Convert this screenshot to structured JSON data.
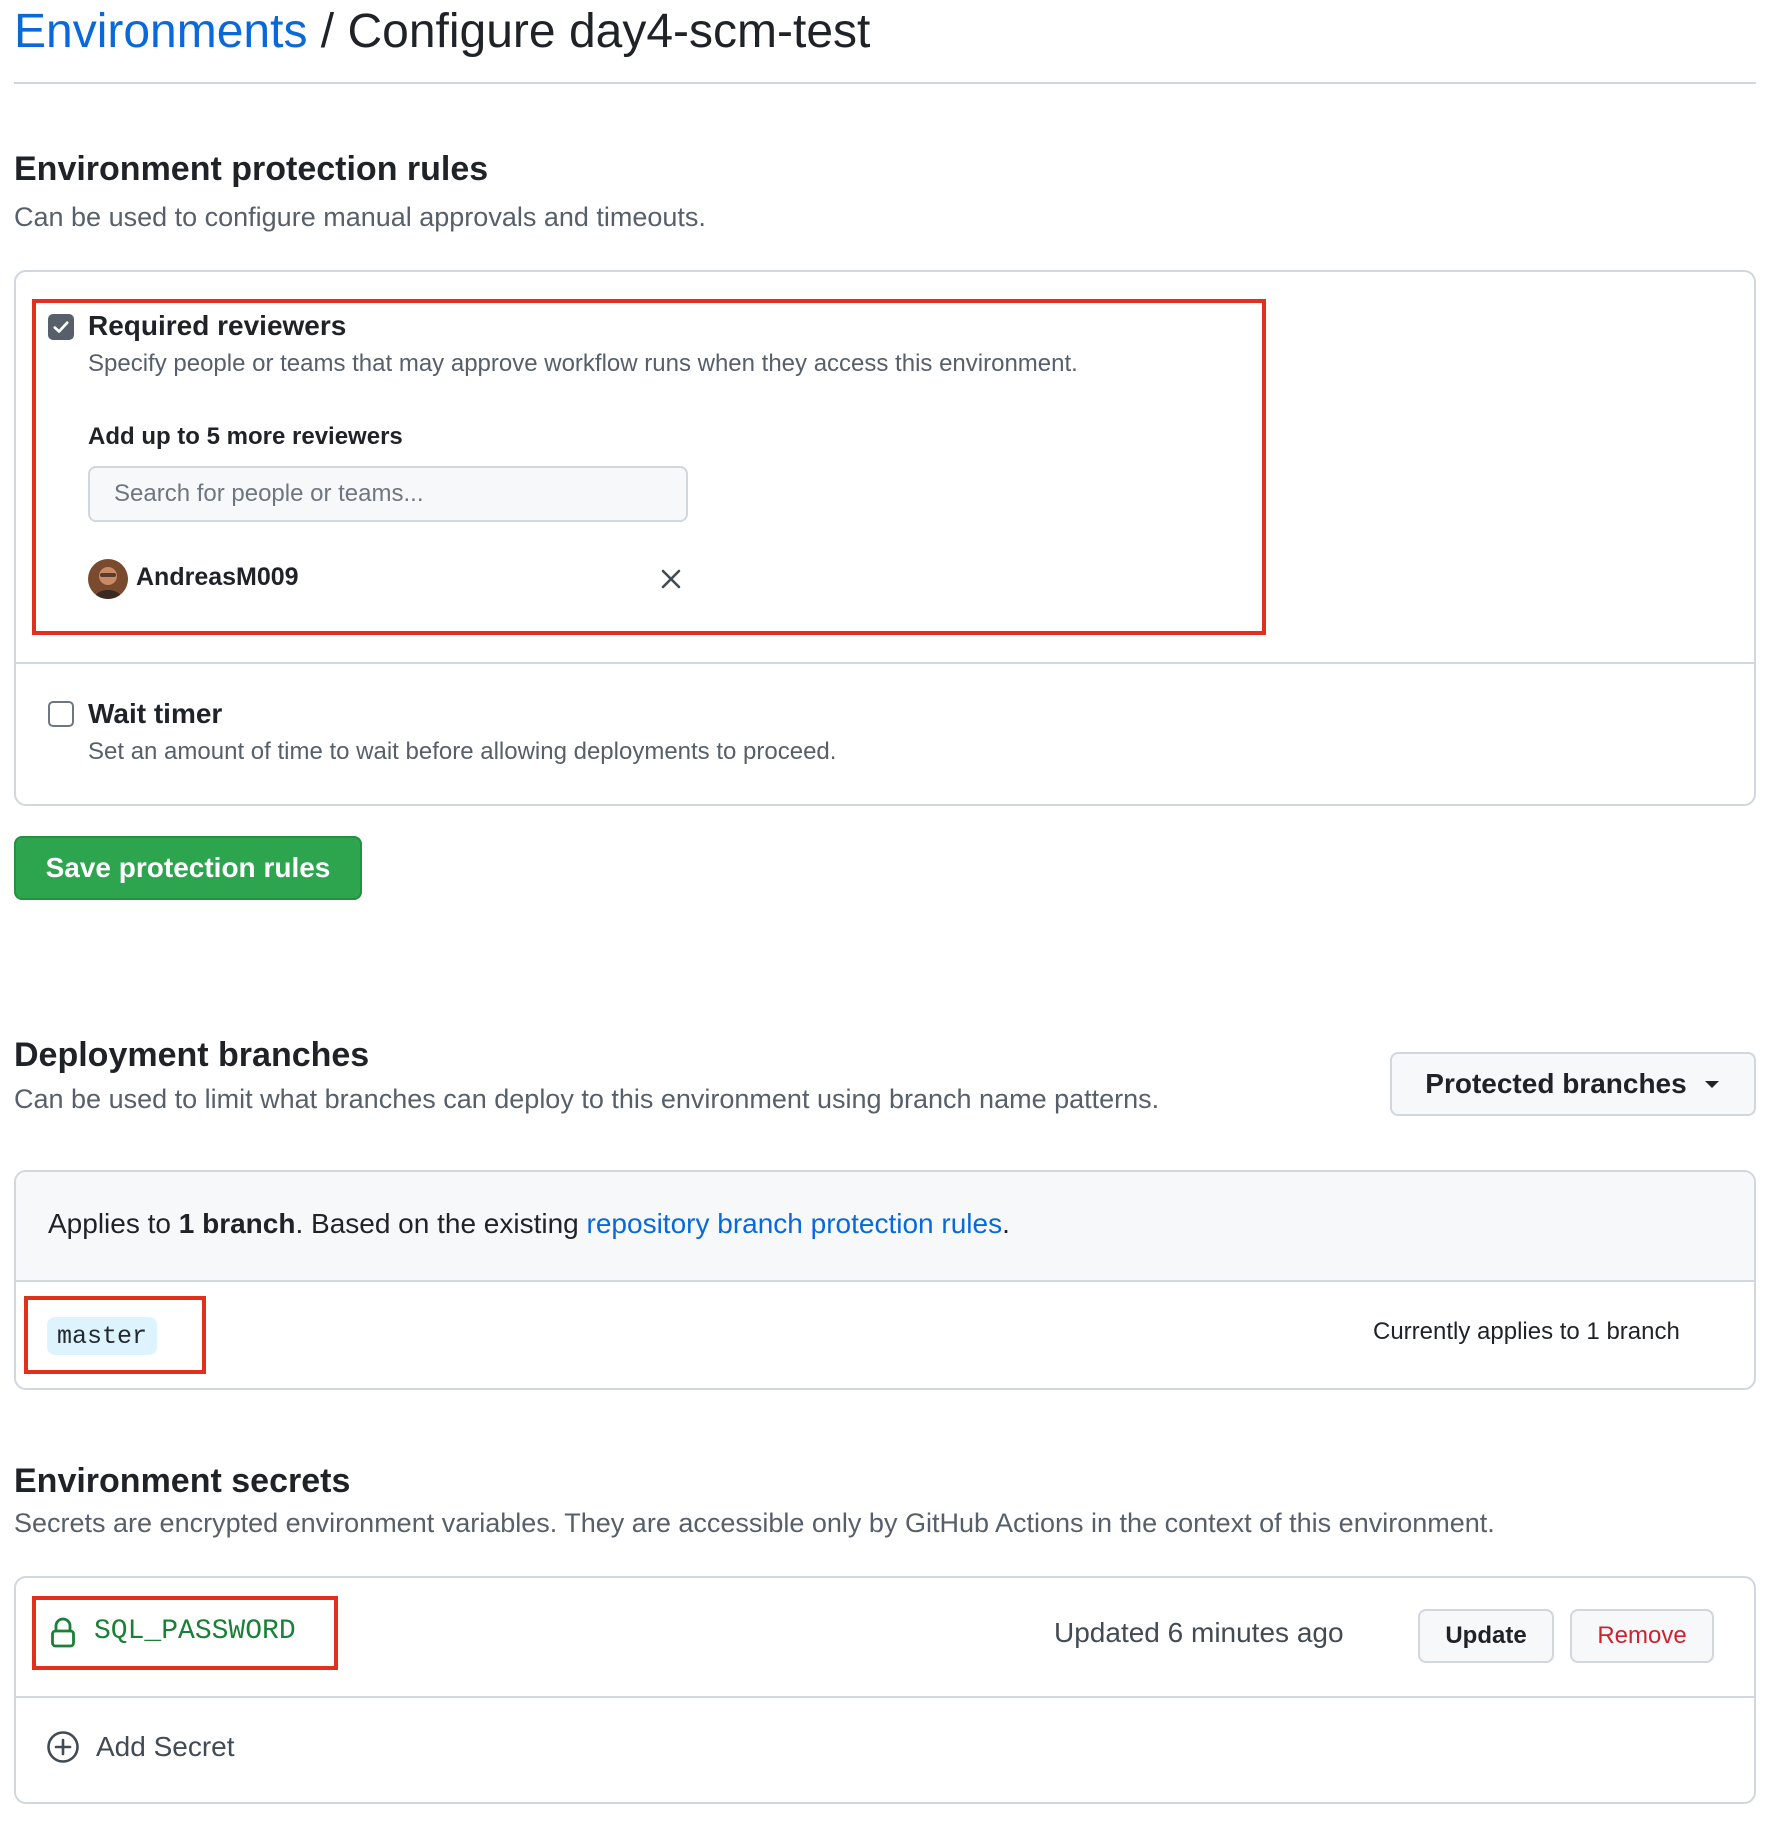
{
  "breadcrumb": {
    "parent": "Environments",
    "separator": " / ",
    "current": "Configure day4-scm-test"
  },
  "protection": {
    "title": "Environment protection rules",
    "description": "Can be used to configure manual approvals and timeouts.",
    "required_reviewers": {
      "checked": true,
      "label": "Required reviewers",
      "description": "Specify people or teams that may approve workflow runs when they access this environment.",
      "add_label": "Add up to 5 more reviewers",
      "search_placeholder": "Search for people or teams...",
      "reviewer": "AndreasM009"
    },
    "wait_timer": {
      "checked": false,
      "label": "Wait timer",
      "description": "Set an amount of time to wait before allowing deployments to proceed."
    },
    "save_button": "Save protection rules"
  },
  "deployment": {
    "title": "Deployment branches",
    "description": "Can be used to limit what branches can deploy to this environment using branch name patterns.",
    "dropdown": "Protected branches",
    "applies_prefix": "Applies to ",
    "applies_bold": "1 branch",
    "applies_middle": ". Based on the existing ",
    "applies_link": "repository branch protection rules",
    "applies_suffix": ".",
    "branch": "master",
    "branch_status": "Currently applies to 1 branch"
  },
  "secrets": {
    "title": "Environment secrets",
    "description": "Secrets are encrypted environment variables. They are accessible only by GitHub Actions in the context of this environment.",
    "items": [
      {
        "name": "SQL_PASSWORD",
        "updated": "Updated 6 minutes ago",
        "update_label": "Update",
        "remove_label": "Remove"
      }
    ],
    "add_label": "Add Secret"
  },
  "colors": {
    "link": "#0969da",
    "primary_green": "#2da44e",
    "danger": "#cf222e",
    "highlight_border": "#e0301e",
    "secret_green": "#1a7f37"
  }
}
